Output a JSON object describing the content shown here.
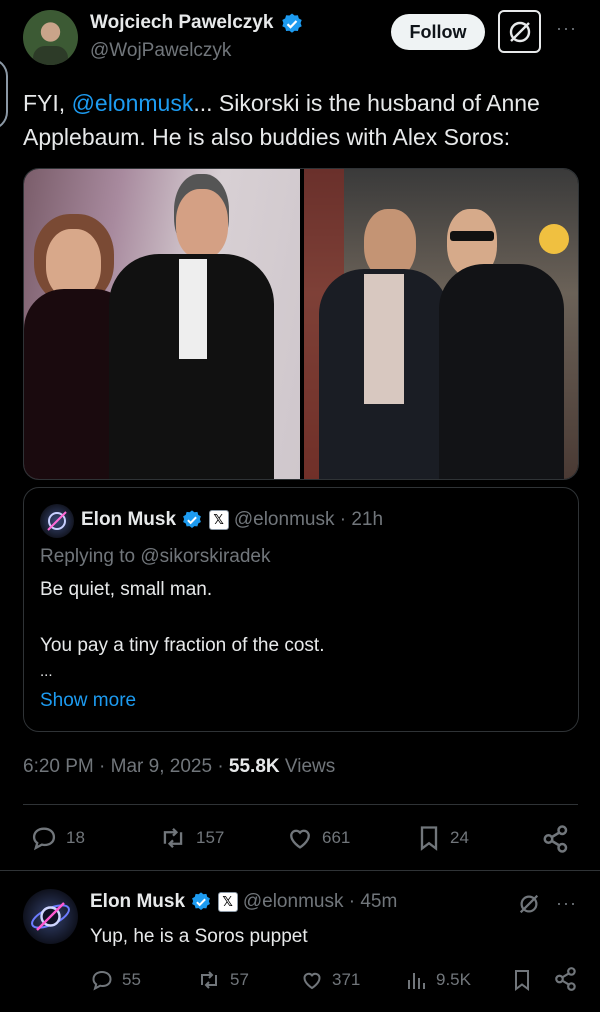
{
  "main_tweet": {
    "author_name": "Wojciech Pawelczyk",
    "author_handle": "@WojPawelczyk",
    "follow_label": "Follow",
    "text_prefix": "FYI, ",
    "mention": "@elonmusk",
    "text_body": "... Sikorski is the husband of Anne Applebaum. He is also buddies with Alex Soros:",
    "time": "6:20 PM · Mar 9, 2025 · ",
    "views_count": "55.8K",
    "views_label": " Views",
    "stats": {
      "replies": "18",
      "reposts": "157",
      "likes": "661",
      "bookmarks": "24"
    }
  },
  "quoted_tweet": {
    "author_name": "Elon Musk",
    "x_badge": "𝕏",
    "author_handle": "@elonmusk",
    "age": " · 21h",
    "replying_prefix": "Replying to ",
    "replying_to": "@sikorskiradek",
    "line1": "Be quiet, small man.",
    "line2": "You pay a tiny fraction of the cost.",
    "ellipsis": "...",
    "show_more": "Show more"
  },
  "reply_tweet": {
    "author_name": "Elon Musk",
    "x_badge": "𝕏",
    "author_handle": "@elonmusk",
    "age": " · 45m",
    "text": "Yup, he is a Soros puppet",
    "stats": {
      "replies": "55",
      "reposts": "57",
      "likes": "371",
      "views": "9.5K"
    }
  },
  "colors": {
    "background": "#000000",
    "text": "#e7e9ea",
    "muted": "#71767b",
    "link": "#1d9bf0",
    "border": "#2f3336"
  }
}
